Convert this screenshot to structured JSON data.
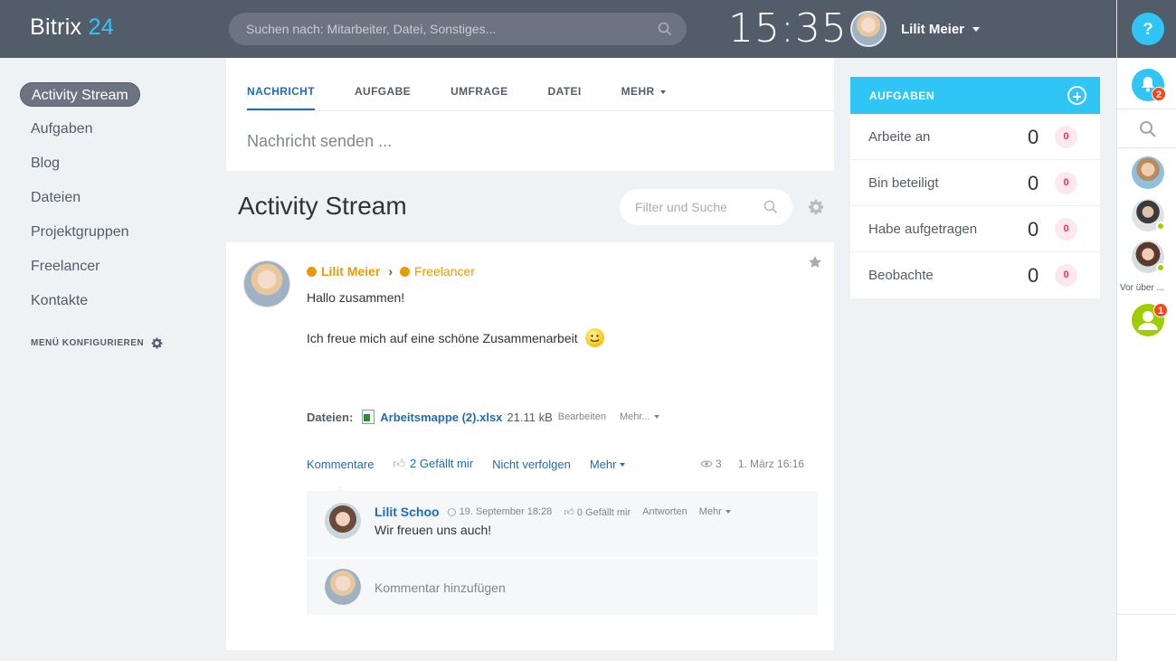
{
  "header": {
    "logo_text": "Bitrix",
    "logo_num": "24",
    "search_placeholder": "Suchen nach: Mitarbeiter, Datei, Sonstiges...",
    "clock": "15:35",
    "user_name": "Lilit Meier"
  },
  "rail": {
    "help": "?",
    "notifications_count": "2",
    "recent_label": "Vor über ...",
    "invite_count": "1"
  },
  "nav": {
    "items": [
      "Activity Stream",
      "Aufgaben",
      "Blog",
      "Dateien",
      "Projektgruppen",
      "Freelancer",
      "Kontakte"
    ],
    "configure": "MENÜ KONFIGURIEREN"
  },
  "postform": {
    "tabs": [
      "NACHRICHT",
      "AUFGABE",
      "UMFRAGE",
      "DATEI",
      "MEHR"
    ],
    "placeholder": "Nachricht senden ..."
  },
  "stream": {
    "title": "Activity Stream",
    "filter_placeholder": "Filter und Suche"
  },
  "post": {
    "author": "Lilit Meier",
    "group": "Freelancer",
    "line1": "Hallo zusammen!",
    "line2": "Ich freue mich auf eine schöne Zusammenarbeit",
    "files_label": "Dateien:",
    "file_name": "Arbeitsmappe (2).xlsx",
    "file_size": "21.11 kB",
    "file_edit": "Bearbeiten",
    "file_more": "Mehr...",
    "action_comments": "Kommentare",
    "like_count": "2",
    "like_label": "Gefällt mir",
    "action_unfollow": "Nicht verfolgen",
    "action_more": "Mehr",
    "views": "3",
    "date": "1. März 16:16"
  },
  "comment": {
    "author": "Lilit Schoo",
    "date": "19. September 18:28",
    "likes": "0 Gefällt mir",
    "reply": "Antworten",
    "more": "Mehr",
    "text": "Wir freuen uns auch!",
    "add_placeholder": "Kommentar hinzufügen"
  },
  "tasks": {
    "title": "AUFGABEN",
    "rows": [
      {
        "label": "Arbeite an",
        "count": "0",
        "counter": "0"
      },
      {
        "label": "Bin beteiligt",
        "count": "0",
        "counter": "0"
      },
      {
        "label": "Habe aufgetragen",
        "count": "0",
        "counter": "0"
      },
      {
        "label": "Beobachte",
        "count": "0",
        "counter": "0"
      }
    ]
  },
  "colors": {
    "header_bg": "#535c69",
    "accent": "#2fc6f6",
    "link": "#1f6cb4",
    "author": "#e89b06"
  }
}
